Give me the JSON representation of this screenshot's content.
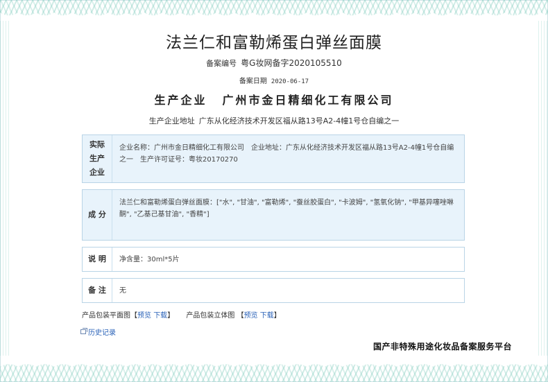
{
  "product_name": "法兰仁和富勒烯蛋白弹丝面膜",
  "record": {
    "number_label": "备案编号",
    "number_value": "粤G妆网备字2020105510",
    "date_label": "备案日期",
    "date_value": "2020-06-17"
  },
  "enterprise": {
    "label": "生产企业",
    "name": "广州市金日精细化工有限公司",
    "address_label": "生产企业地址",
    "address_value": "广东从化经济技术开发区福从路13号A2-4幢1号仓自编之一"
  },
  "sections": {
    "actual": {
      "label_lines": [
        "实际",
        "生产",
        "企业"
      ],
      "text": "企业名称：广州市金日精细化工有限公司　企业地址：广东从化经济技术开发区福从路13号A2-4幢1号仓自编之一　生产许可证号：粤妆20170270"
    },
    "ingredients": {
      "label": "成 分",
      "text": "法兰仁和富勒烯蛋白弹丝面膜：[\"水\", \"甘油\", \"富勒烯\", \"蚕丝胶蛋白\", \"卡波姆\", \"氢氧化钠\", \"甲基异噻唑啉酮\", \"乙基己基甘油\", \"香精\"]"
    },
    "description": {
      "label": "说 明",
      "text": "净含量：30ml*5片"
    },
    "remarks": {
      "label": "备 注",
      "text": "无"
    }
  },
  "links": {
    "flat_label": "产品包装平面图",
    "solid_label": "产品包装立体图",
    "open_bracket": "【",
    "close_bracket": "】",
    "preview": "预览",
    "download": "下载"
  },
  "history": "历史记录",
  "platform_name": "国产非特殊用途化妆品备案服务平台",
  "colors": {
    "accent_blue": "#2a62b8",
    "box_border": "#b9d4e6",
    "box_fill": "#e8f3fb",
    "wave": "#78c8b9"
  }
}
